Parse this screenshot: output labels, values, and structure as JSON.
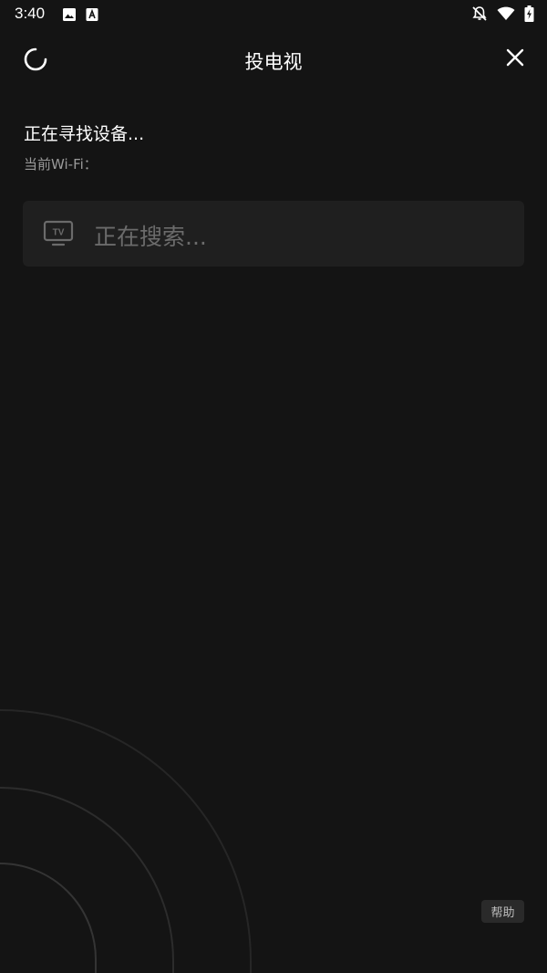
{
  "status_bar": {
    "time": "3:40",
    "icons": [
      "image-icon",
      "a-letter-icon",
      "notifications-off-icon",
      "wifi-icon",
      "battery-charging-icon"
    ]
  },
  "header": {
    "title": "投电视",
    "refresh_icon": "refresh-spinner-icon",
    "close_icon": "close-icon"
  },
  "search": {
    "title": "正在寻找设备...",
    "wifi_label": "当前Wi-Fi："
  },
  "device_card": {
    "icon": "tv-icon",
    "icon_text": "TV",
    "status": "正在搜索..."
  },
  "help": {
    "label": "帮助"
  },
  "colors": {
    "background": "#141414",
    "card": "#1f1f1f",
    "muted_text": "#9a9a9a",
    "placeholder_text": "#6b6b6b"
  }
}
